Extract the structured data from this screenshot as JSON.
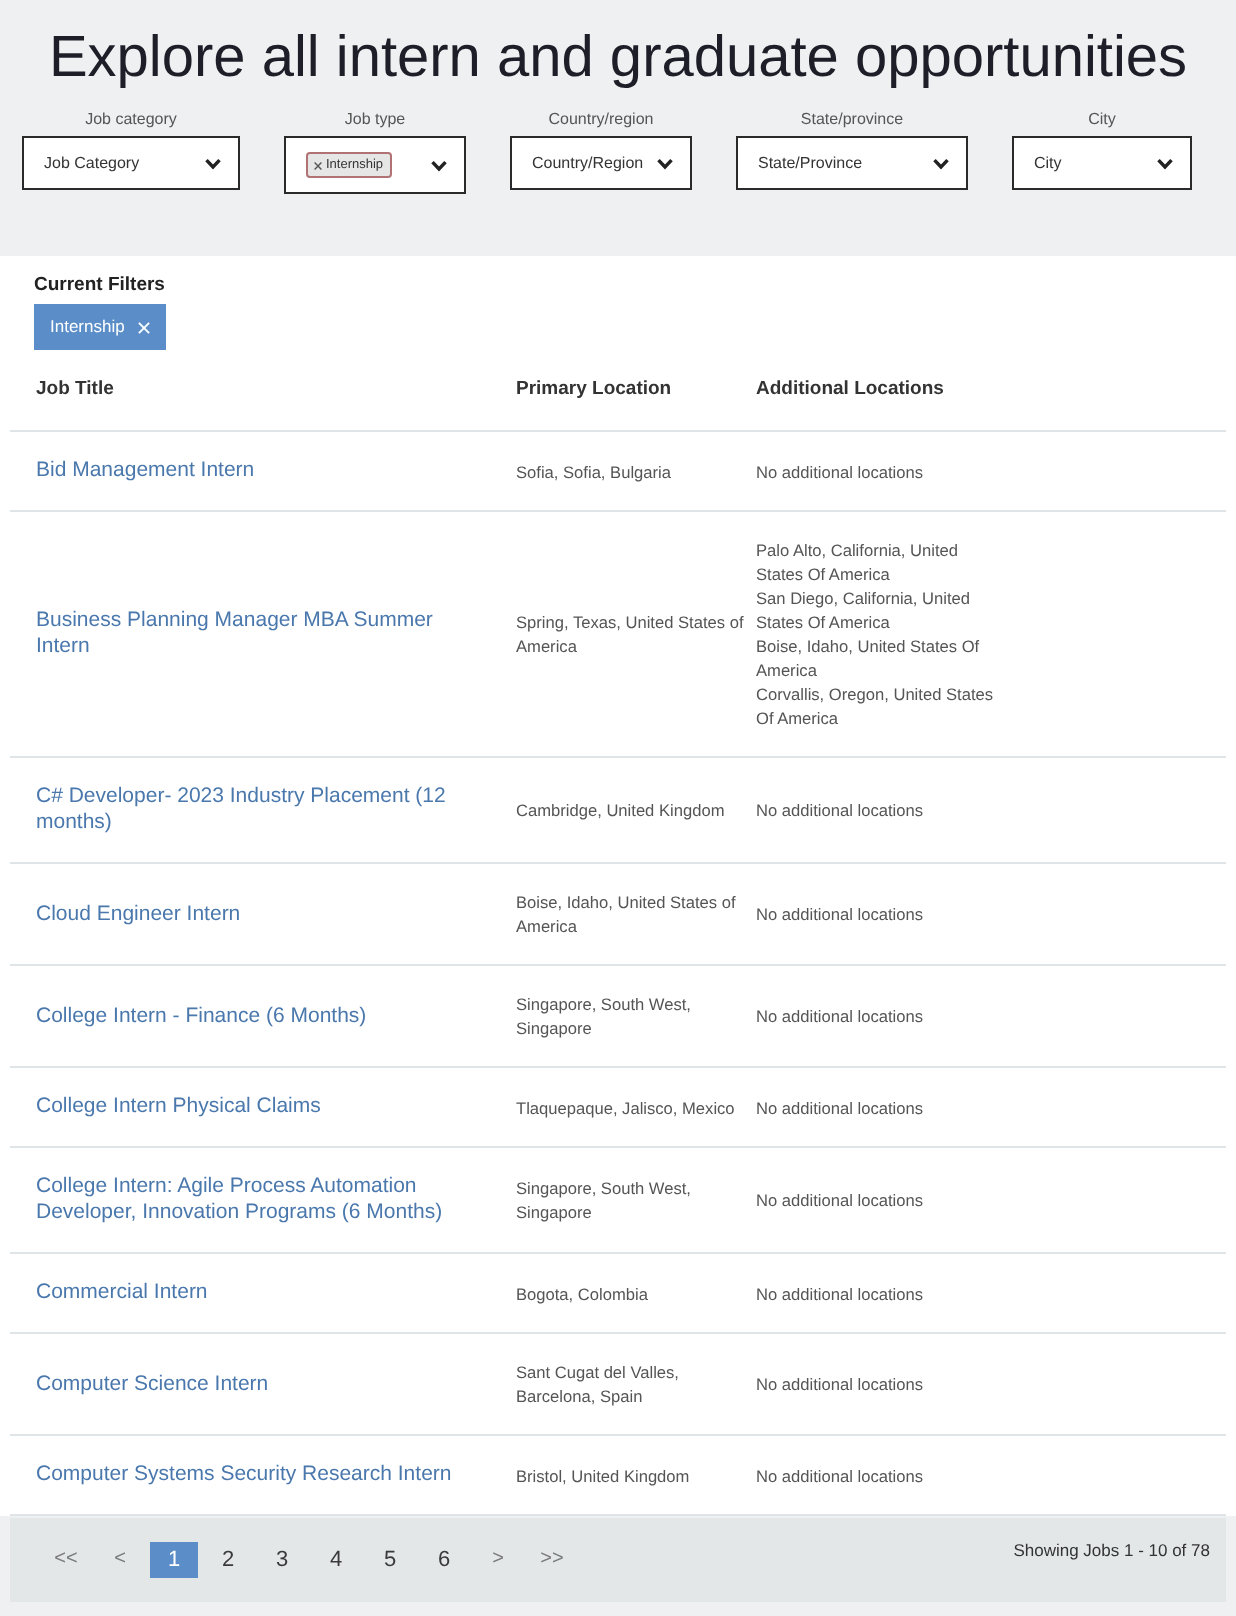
{
  "page_title": "Explore all intern and graduate opportunities",
  "filters": [
    {
      "kind": "select",
      "label": "Job category",
      "value": "Job Category"
    },
    {
      "kind": "tags",
      "label": "Job type",
      "tags": [
        "Internship"
      ]
    },
    {
      "kind": "select",
      "label": "Country/region",
      "value": "Country/Region"
    },
    {
      "kind": "select",
      "label": "State/province",
      "value": "State/Province"
    },
    {
      "kind": "select",
      "label": "City",
      "value": "City"
    }
  ],
  "current_filters": {
    "heading": "Current Filters",
    "chips": [
      "Internship"
    ]
  },
  "table": {
    "columns": [
      "Job Title",
      "Primary Location",
      "Additional Locations"
    ],
    "rows": [
      {
        "title": "Bid Management Intern",
        "primary_location": "Sofia, Sofia, Bulgaria",
        "additional_locations": [
          "No additional locations"
        ]
      },
      {
        "title": "Business Planning Manager MBA Summer Intern",
        "primary_location": "Spring, Texas, United States of America",
        "additional_locations": [
          "Palo Alto, California, United States Of America",
          "San Diego, California, United States Of America",
          "Boise, Idaho, United States Of America",
          "Corvallis, Oregon, United States Of America"
        ]
      },
      {
        "title": "C# Developer- 2023 Industry Placement (12 months)",
        "primary_location": "Cambridge, United Kingdom",
        "additional_locations": [
          "No additional locations"
        ]
      },
      {
        "title": "Cloud Engineer Intern",
        "primary_location": "Boise, Idaho, United States of America",
        "additional_locations": [
          "No additional locations"
        ]
      },
      {
        "title": "College Intern - Finance (6 Months)",
        "primary_location": "Singapore, South West, Singapore",
        "additional_locations": [
          "No additional locations"
        ]
      },
      {
        "title": "College Intern Physical Claims",
        "primary_location": "Tlaquepaque, Jalisco, Mexico",
        "additional_locations": [
          "No additional locations"
        ]
      },
      {
        "title": "College Intern: Agile Process Automation Developer, Innovation Programs (6 Months)",
        "primary_location": "Singapore, South West, Singapore",
        "additional_locations": [
          "No additional locations"
        ]
      },
      {
        "title": "Commercial Intern",
        "primary_location": "Bogota, Colombia",
        "additional_locations": [
          "No additional locations"
        ]
      },
      {
        "title": "Computer Science Intern",
        "primary_location": "Sant Cugat del Valles, Barcelona, Spain",
        "additional_locations": [
          "No additional locations"
        ]
      },
      {
        "title": "Computer Systems Security Research Intern",
        "primary_location": "Bristol, United Kingdom",
        "additional_locations": [
          "No additional locations"
        ]
      }
    ]
  },
  "pagination": {
    "pages": [
      {
        "kind": "arrow",
        "label": "<<",
        "selected": false
      },
      {
        "kind": "arrow",
        "label": "<",
        "selected": false
      },
      {
        "kind": "number",
        "label": "1",
        "selected": true
      },
      {
        "kind": "number",
        "label": "2",
        "selected": false
      },
      {
        "kind": "number",
        "label": "3",
        "selected": false
      },
      {
        "kind": "number",
        "label": "4",
        "selected": false
      },
      {
        "kind": "number",
        "label": "5",
        "selected": false
      },
      {
        "kind": "number",
        "label": "6",
        "selected": false
      },
      {
        "kind": "arrow",
        "label": ">",
        "selected": false
      },
      {
        "kind": "arrow",
        "label": ">>",
        "selected": false
      }
    ],
    "summary": "Showing Jobs 1 - 10 of 78"
  }
}
